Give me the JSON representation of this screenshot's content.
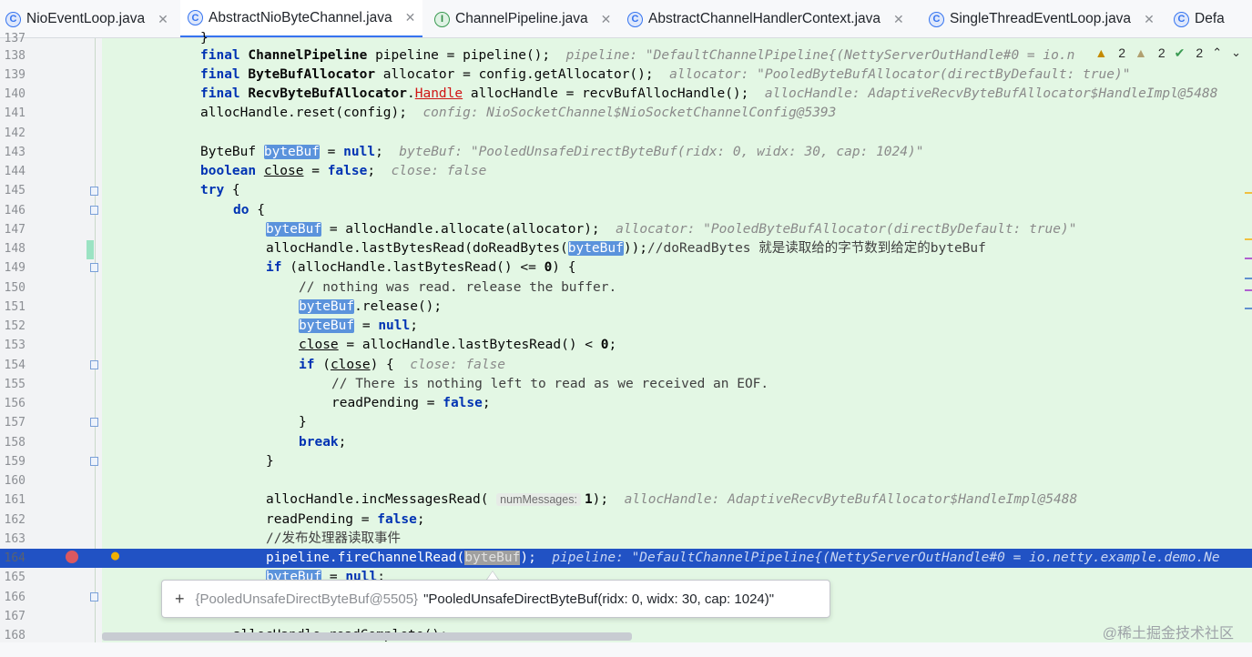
{
  "tabs": [
    {
      "label": "NioEventLoop.java",
      "icon": "class-icon",
      "active": false
    },
    {
      "label": "AbstractNioByteChannel.java",
      "icon": "class-icon",
      "active": true
    },
    {
      "label": "ChannelPipeline.java",
      "icon": "interface-icon",
      "active": false
    },
    {
      "label": "AbstractChannelHandlerContext.java",
      "icon": "class-icon",
      "active": false
    },
    {
      "label": "SingleThreadEventLoop.java",
      "icon": "class-icon",
      "active": false
    },
    {
      "label": "Defa",
      "icon": "class-icon",
      "active": false
    }
  ],
  "inspections": {
    "warnings": "2",
    "weak_warnings": "2",
    "checks": "2"
  },
  "lines": {
    "n137": "137",
    "n138": "138",
    "n139": "139",
    "n140": "140",
    "n141": "141",
    "n142": "142",
    "n143": "143",
    "n144": "144",
    "n145": "145",
    "n146": "146",
    "n147": "147",
    "n148": "148",
    "n149": "149",
    "n150": "150",
    "n151": "151",
    "n152": "152",
    "n153": "153",
    "n154": "154",
    "n155": "155",
    "n156": "156",
    "n157": "157",
    "n158": "158",
    "n159": "159",
    "n160": "160",
    "n161": "161",
    "n162": "162",
    "n163": "163",
    "n164": "164",
    "n165": "165",
    "n166": "166",
    "n167": "167",
    "n168": "168"
  },
  "debug": {
    "d138": "pipeline: \"DefaultChannelPipeline{(NettyServerOutHandle#0 = io.n",
    "d139": "allocator: \"PooledByteBufAllocator(directByDefault: true)\"",
    "d140": "allocHandle: AdaptiveRecvByteBufAllocator$HandleImpl@5488",
    "d141": "config: NioSocketChannel$NioSocketChannelConfig@5393",
    "d143": "byteBuf: \"PooledUnsafeDirectByteBuf(ridx: 0, widx: 30, cap: 1024)\"",
    "d144": "close: false",
    "d147": "allocator: \"PooledByteBufAllocator(directByDefault: true)\"",
    "d154": "close: false",
    "d161": "allocHandle: AdaptiveRecvByteBufAllocator$HandleImpl@5488",
    "d164": "pipeline: \"DefaultChannelPipeline{(NettyServerOutHandle#0 = io.netty.example.demo.Ne"
  },
  "comments": {
    "c148": "//doReadBytes 就是读取给的字节数到给定的byteBuf",
    "c150": "// nothing was read. release the buffer.",
    "c155": "// There is nothing left to read as we received an EOF.",
    "c163": "//发布处理器读取事件"
  },
  "param_hint": "numMessages:",
  "popup": {
    "ref": "{PooledUnsafeDirectByteBuf@5505}",
    "value": "\"PooledUnsafeDirectByteBuf(ridx: 0, widx: 30, cap: 1024)\""
  },
  "watermark": "@稀土掘金技术社区"
}
